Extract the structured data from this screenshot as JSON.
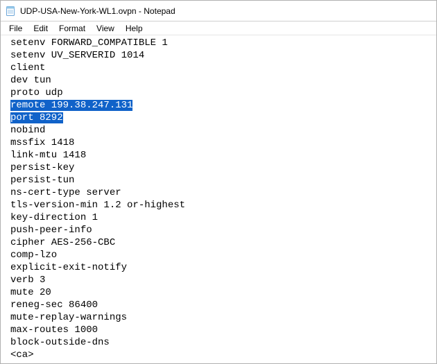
{
  "window": {
    "title": "UDP-USA-New-York-WL1.ovpn - Notepad"
  },
  "menu": {
    "file": "File",
    "edit": "Edit",
    "format": "Format",
    "view": "View",
    "help": "Help"
  },
  "editor": {
    "lines": [
      {
        "text": "setenv FORWARD_COMPATIBLE 1",
        "selected": false
      },
      {
        "text": "setenv UV_SERVERID 1014",
        "selected": false
      },
      {
        "text": "client",
        "selected": false
      },
      {
        "text": "dev tun",
        "selected": false
      },
      {
        "text": "proto udp",
        "selected": false
      },
      {
        "text": "remote 199.38.247.131",
        "selected": true
      },
      {
        "text": "port 8292",
        "selected": true
      },
      {
        "text": "nobind",
        "selected": false
      },
      {
        "text": "mssfix 1418",
        "selected": false
      },
      {
        "text": "link-mtu 1418",
        "selected": false
      },
      {
        "text": "persist-key",
        "selected": false
      },
      {
        "text": "persist-tun",
        "selected": false
      },
      {
        "text": "ns-cert-type server",
        "selected": false
      },
      {
        "text": "tls-version-min 1.2 or-highest",
        "selected": false
      },
      {
        "text": "key-direction 1",
        "selected": false
      },
      {
        "text": "push-peer-info",
        "selected": false
      },
      {
        "text": "cipher AES-256-CBC",
        "selected": false
      },
      {
        "text": "comp-lzo",
        "selected": false
      },
      {
        "text": "explicit-exit-notify",
        "selected": false
      },
      {
        "text": "verb 3",
        "selected": false
      },
      {
        "text": "mute 20",
        "selected": false
      },
      {
        "text": "reneg-sec 86400",
        "selected": false
      },
      {
        "text": "mute-replay-warnings",
        "selected": false
      },
      {
        "text": "max-routes 1000",
        "selected": false
      },
      {
        "text": "block-outside-dns",
        "selected": false
      },
      {
        "text": "<ca>",
        "selected": false
      }
    ]
  }
}
